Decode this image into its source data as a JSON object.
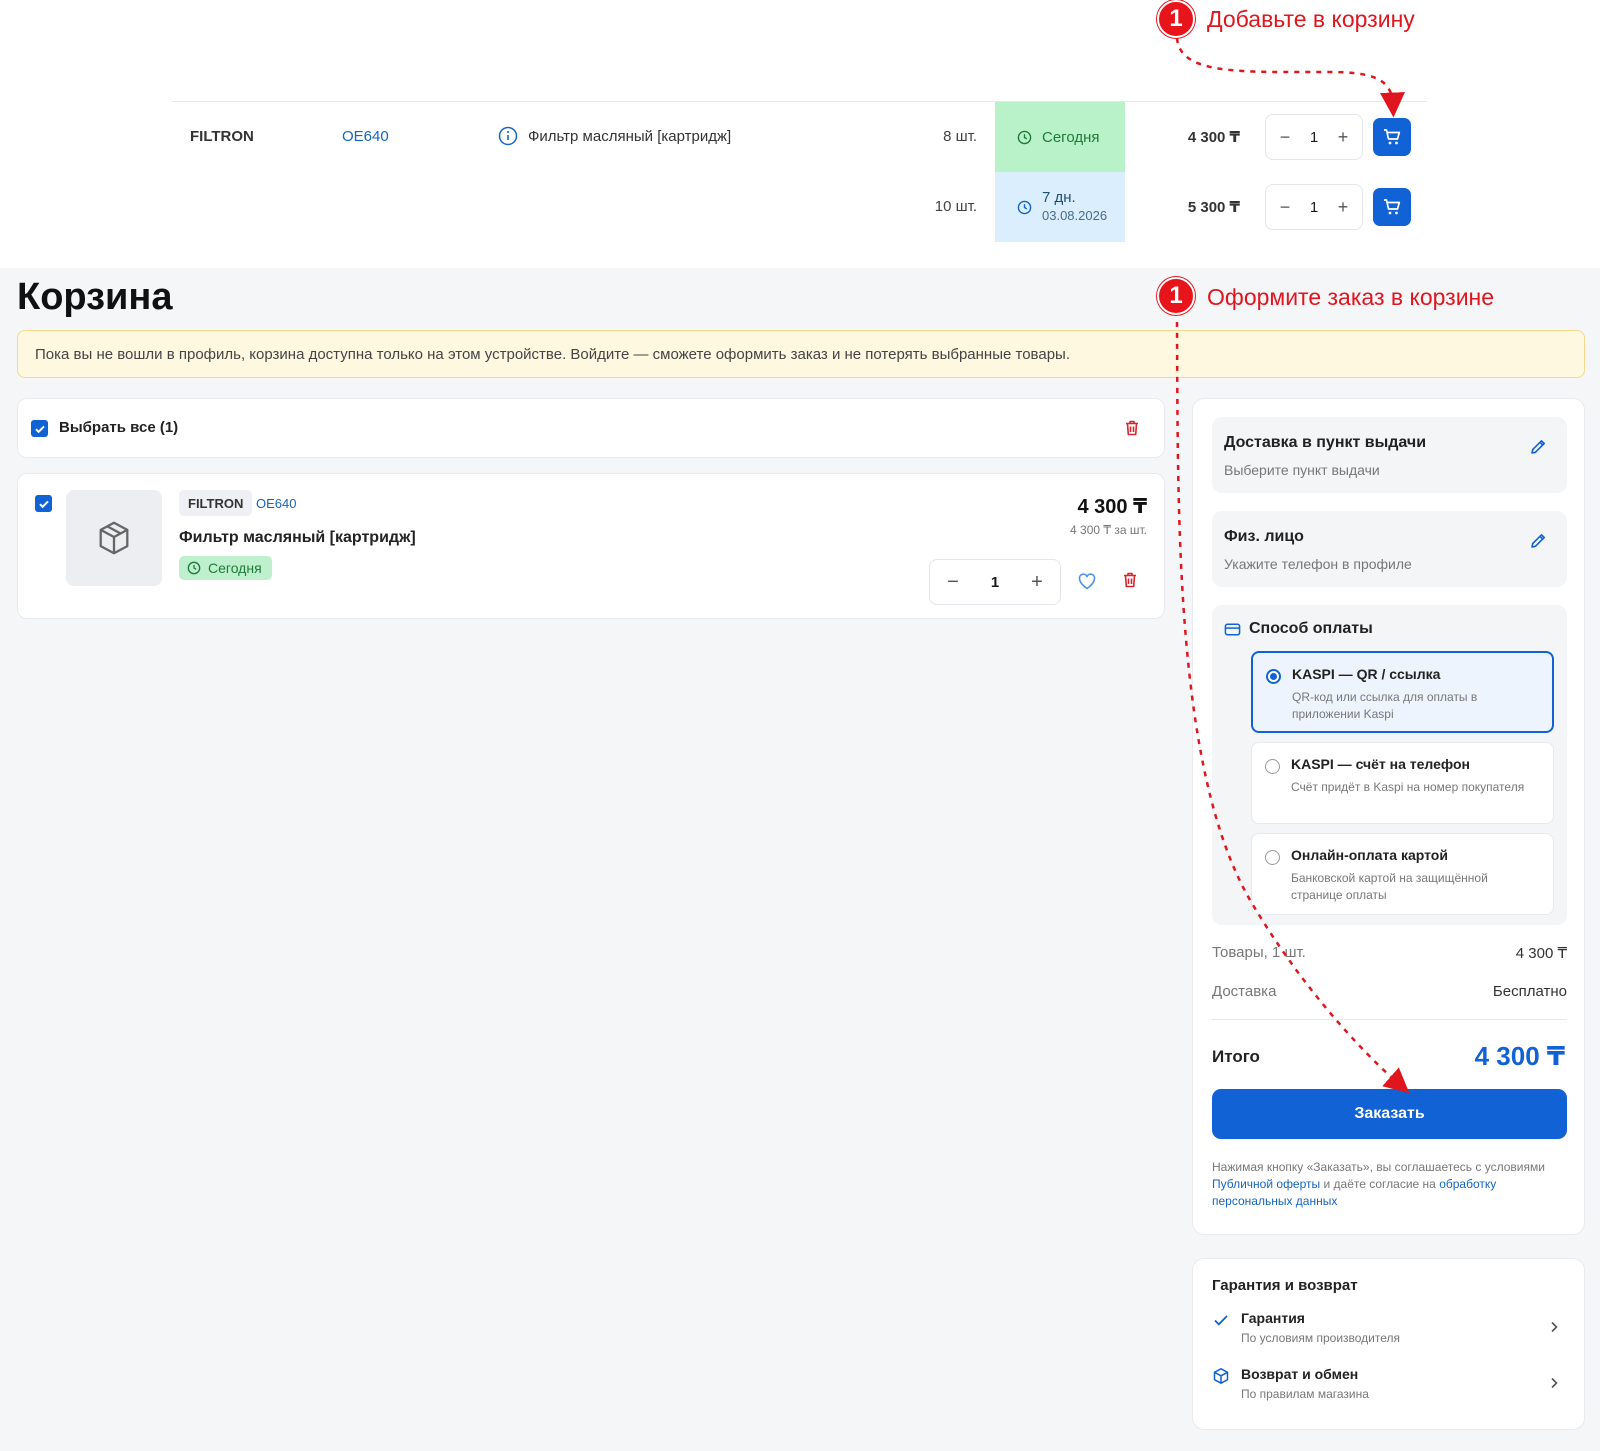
{
  "annotations": {
    "step1_badge": "1",
    "step1_text": "Добавьте в корзину",
    "step2_badge": "1",
    "step2_text": "Оформите заказ в корзине"
  },
  "offers": [
    {
      "brand": "FILTRON",
      "article": "OE640",
      "description": "Фильтр масляный [картридж]",
      "qty": "8 шт.",
      "delivery": "Сегодня",
      "delivery_date": "",
      "price": "4 300 ₸",
      "count": "1"
    },
    {
      "brand": "",
      "article": "",
      "description": "",
      "qty": "10 шт.",
      "delivery": "7 дн.",
      "delivery_date": "03.08.2026",
      "price": "5 300 ₸",
      "count": "1"
    }
  ],
  "cart": {
    "title": "Корзина",
    "notice": "Пока вы не вошли в профиль, корзина доступна только на этом устройстве. Войдите — сможете оформить заказ и не потерять выбранные товары.",
    "select_all": "Выбрать все (1)",
    "item": {
      "brand": "FILTRON",
      "article": "OE640",
      "name": "Фильтр масляный [картридж]",
      "delivery": "Сегодня",
      "price": "4 300 ₸",
      "unit_price": "4 300 ₸ за шт.",
      "count": "1"
    }
  },
  "summary": {
    "delivery_title": "Доставка в пункт выдачи",
    "delivery_sub": "Выберите пункт выдачи",
    "person_title": "Физ. лицо",
    "person_sub": "Укажите телефон в профиле",
    "payment_title": "Способ оплаты",
    "payment_options": [
      {
        "title": "KASPI — QR / ссылка",
        "desc": "QR-код или ссылка для оплаты в приложении Kaspi",
        "selected": true
      },
      {
        "title": "KASPI — счёт на телефон",
        "desc": "Счёт придёт в Kaspi на номер покупателя",
        "selected": false
      },
      {
        "title": "Онлайн-оплата картой",
        "desc": "Банковской картой на защищённой странице оплаты",
        "selected": false
      }
    ],
    "goods_label": "Товары, 1 шт.",
    "goods_value": "4 300 ₸",
    "delivery_label": "Доставка",
    "delivery_value": "Бесплатно",
    "total_label": "Итого",
    "total_value": "4 300 ₸",
    "order_button": "Заказать",
    "legal_1": "Нажимая кнопку «Заказать», вы соглашаетесь с условиями ",
    "legal_link1": "Публичной оферты",
    "legal_2": " и даёте согласие на ",
    "legal_link2": "обработку персональных данных"
  },
  "guarantee": {
    "title": "Гарантия и возврат",
    "items": [
      {
        "name": "Гарантия",
        "sub": "По условиям производителя"
      },
      {
        "name": "Возврат и обмен",
        "sub": "По правилам магазина"
      }
    ]
  },
  "colors": {
    "accent": "#1162d4",
    "annotation": "#e8141c",
    "today_bg": "#b9f2c9",
    "days_bg": "#dbeefe",
    "notice_bg": "#fff8e1"
  }
}
